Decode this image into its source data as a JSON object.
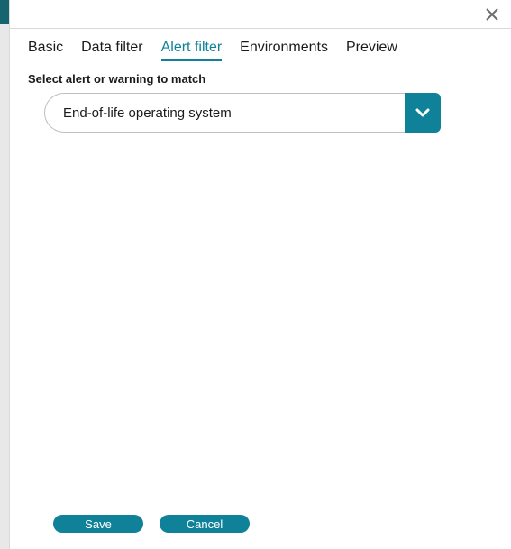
{
  "tabs": {
    "basic": "Basic",
    "data_filter": "Data filter",
    "alert_filter": "Alert filter",
    "environments": "Environments",
    "preview": "Preview"
  },
  "form": {
    "select_label": "Select alert or warning to match",
    "select_value": "End-of-life operating system"
  },
  "footer": {
    "save": "Save",
    "cancel": "Cancel"
  },
  "colors": {
    "accent": "#0f8299"
  }
}
